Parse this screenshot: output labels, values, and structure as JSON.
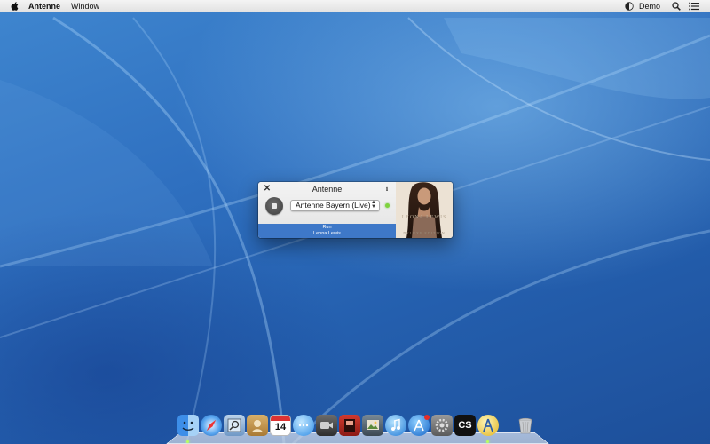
{
  "menubar": {
    "app_name": "Antenne",
    "menus": [
      "Window"
    ],
    "user_name": "Demo",
    "icons": [
      "apple-icon",
      "status-icon",
      "search-icon",
      "notification-list-icon"
    ]
  },
  "window": {
    "title": "Antenne",
    "close_glyph": "✕",
    "info_glyph": "i",
    "station": "Antenne Bayern (Live)",
    "station_arrows": "▲▼",
    "track": "Run",
    "artist": "Leona Lewis",
    "status_color": "#7ed33d",
    "now_playing_bg": "#3e78c8"
  },
  "album": {
    "artist_text": "LEONA LEWIS",
    "edition_text": "DELUXE EDITION"
  },
  "dock": {
    "calendar_day": "14",
    "cs_label": "CS",
    "apps": [
      "finder-icon",
      "safari-icon",
      "preview-icon",
      "contacts-icon",
      "calendar-icon",
      "messages-icon",
      "facetime-icon",
      "photo-booth-icon",
      "iphoto-icon",
      "itunes-icon",
      "app-store-icon",
      "system-preferences-icon",
      "cs-app-icon",
      "antenne-icon",
      "trash-icon"
    ]
  }
}
